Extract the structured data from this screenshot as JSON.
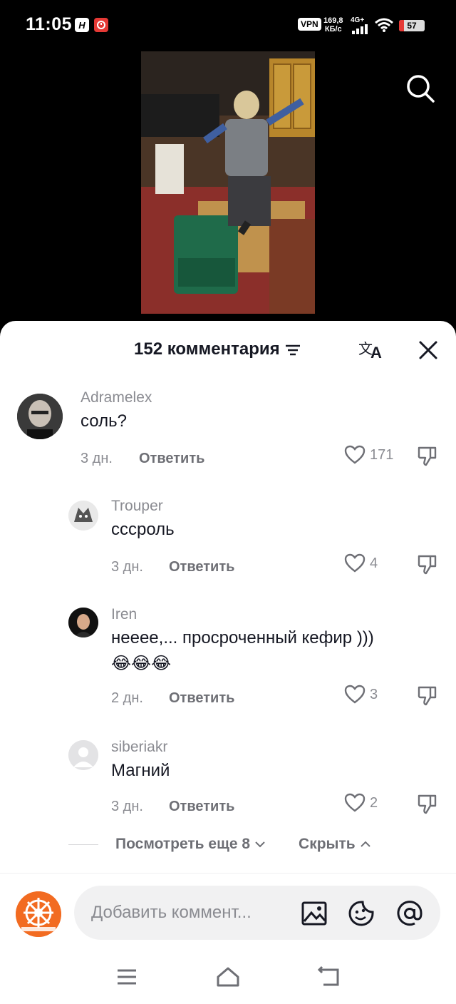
{
  "status": {
    "time": "11:05",
    "badge_h": "H",
    "vpn": "VPN",
    "speed_value": "169,8",
    "speed_unit": "КБ/с",
    "network": "4G+",
    "battery": "57",
    "battery_level": 0.57
  },
  "sheet": {
    "title": "152 комментария"
  },
  "comments": [
    {
      "user": "Adramelex",
      "text": "соль?",
      "date": "3 дн.",
      "reply": "Ответить",
      "likes": "171"
    },
    {
      "user": "Trouper",
      "text": "сссроль",
      "date": "3 дн.",
      "reply": "Ответить",
      "likes": "4"
    },
    {
      "user": "Iren",
      "text": "нееее,... просроченный кефир )))",
      "emoji": "😂😂😂",
      "date": "2 дн.",
      "reply": "Ответить",
      "likes": "3"
    },
    {
      "user": "siberiakr",
      "text": "Магний",
      "date": "3 дн.",
      "reply": "Ответить",
      "likes": "2"
    }
  ],
  "replies_nav": {
    "view_more": "Посмотреть еще 8",
    "hide": "Скрыть"
  },
  "input": {
    "placeholder": "Добавить коммент..."
  },
  "colors": {
    "sheet_bg": "#ffffff",
    "text_primary": "#161823",
    "text_secondary": "#8a8b91",
    "input_bg": "#f1f1f2",
    "brand_orange": "#f26b21"
  }
}
